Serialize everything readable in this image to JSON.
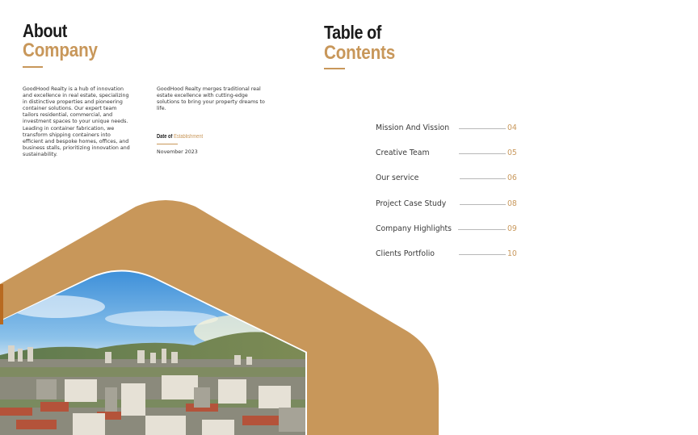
{
  "about": {
    "title_line1": "About",
    "title_line2": "Company",
    "paragraph1": "GoodHood Realty is a hub of innovation and excellence in real estate, specializing in distinctive properties and pioneering container solutions. Our expert team tailors residential, commercial, and investment spaces to your unique needs. Leading in container fabrication, we transform shipping containers into efficient and bespoke homes, offices, and business stalls, prioritizing innovation and sustainability.",
    "paragraph2": "GoodHood Realty merges traditional real estate excellence with cutting-edge solutions to bring your property dreams to life.",
    "date_label_dark": "Date of",
    "date_label_gold": "Establishment",
    "date_value": "November 2023"
  },
  "toc": {
    "title_line1": "Table of",
    "title_line2": "Contents",
    "items": [
      {
        "label": "Mission And Vission",
        "page": "04"
      },
      {
        "label": "Creative Team",
        "page": "05"
      },
      {
        "label": "Our service",
        "page": "06"
      },
      {
        "label": "Project Case Study",
        "page": "08"
      },
      {
        "label": "Company Highlights",
        "page": "09"
      },
      {
        "label": "Clients Portfolio",
        "page": "10"
      }
    ]
  },
  "colors": {
    "accent": "#c8975a",
    "text_dark": "#1b1b1b",
    "text_body": "#333333",
    "rule_gray": "#b8b8b8"
  },
  "image": {
    "subject": "city-skyline-photo"
  }
}
